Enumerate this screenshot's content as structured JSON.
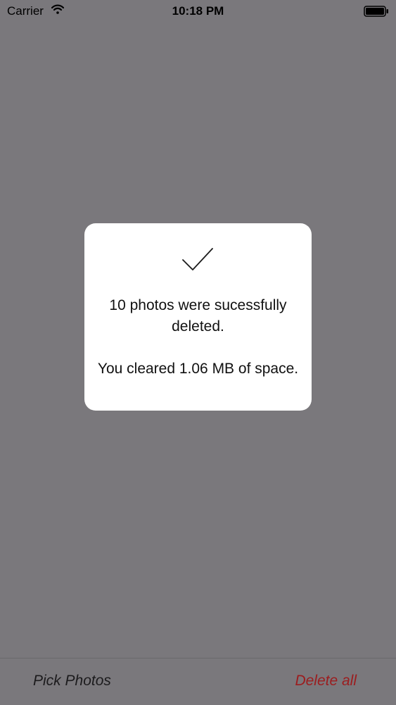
{
  "status_bar": {
    "carrier": "Carrier",
    "time": "10:18 PM",
    "wifi_icon": "wifi-icon",
    "battery_icon": "battery-icon"
  },
  "alert": {
    "icon": "checkmark-icon",
    "message_line_1": "10 photos were sucessfully deleted.",
    "message_line_2": "You cleared 1.06 MB of space."
  },
  "toolbar": {
    "pick_photos_label": "Pick Photos",
    "delete_all_label": "Delete all",
    "delete_color": "#9c1c1e"
  },
  "colors": {
    "overlay_background": "#7a787c",
    "alert_background": "#ffffff"
  }
}
